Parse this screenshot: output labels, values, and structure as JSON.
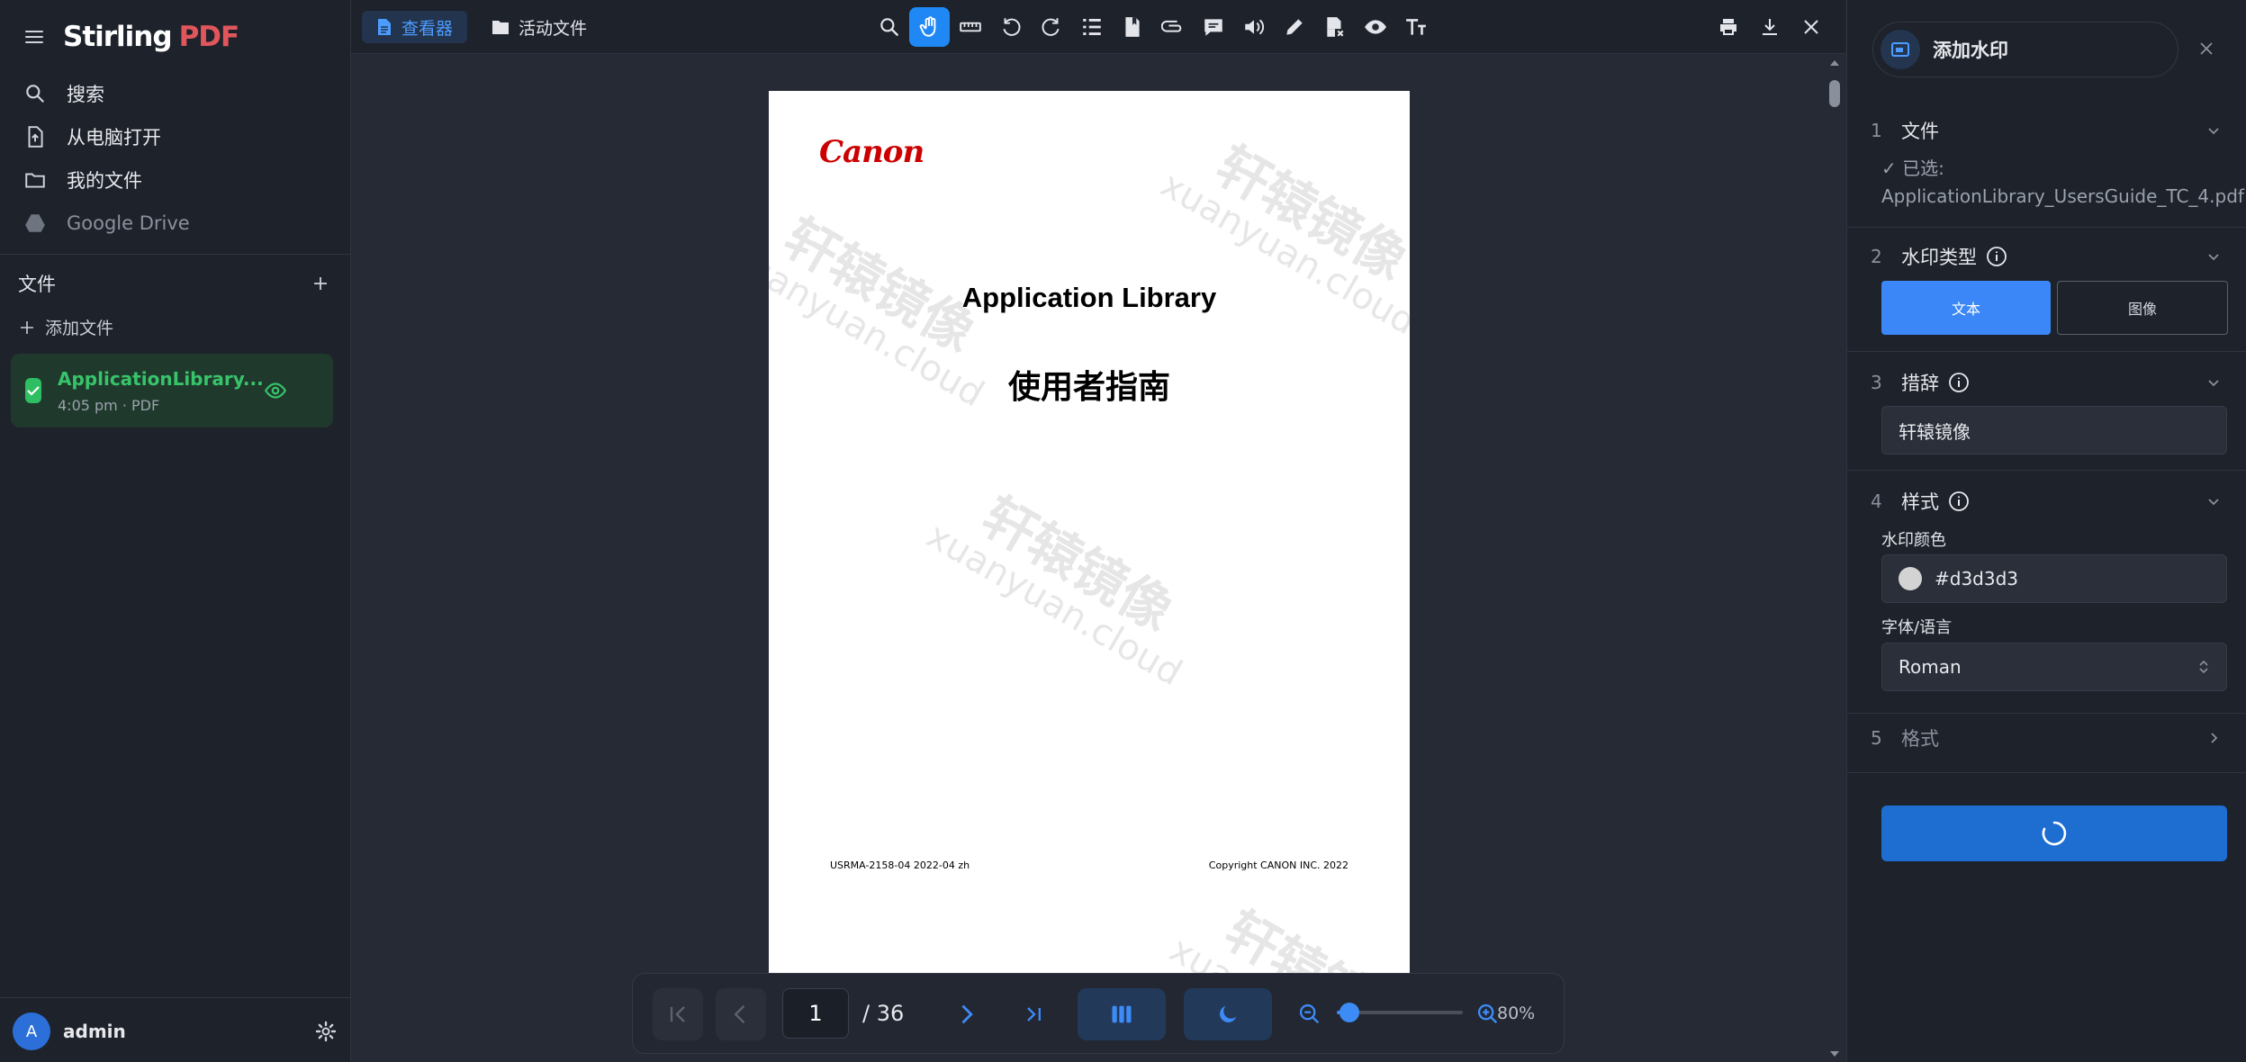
{
  "app": {
    "logo_main": "Stirling",
    "logo_accent": "PDF"
  },
  "sidebar": {
    "nav": [
      {
        "label": "搜索",
        "icon": "search-icon"
      },
      {
        "label": "从电脑打开",
        "icon": "file-upload-icon"
      },
      {
        "label": "我的文件",
        "icon": "folder-icon"
      },
      {
        "label": "Google Drive",
        "icon": "google-drive-icon"
      }
    ],
    "files_title": "文件",
    "add_file_label": "添加文件",
    "file": {
      "name": "ApplicationLibrary...",
      "meta": "4:05 pm · PDF"
    },
    "user": {
      "initial": "A",
      "name": "admin"
    }
  },
  "topbar": {
    "tab_viewer": "查看器",
    "tab_active_files": "活动文件",
    "tools": [
      "search-icon",
      "pan-hand-icon",
      "ruler-icon",
      "rotate-left-icon",
      "rotate-right-icon",
      "list-icon",
      "bookmark-file-icon",
      "paperclip-icon",
      "comment-icon",
      "speaker-icon",
      "pen-icon",
      "file-remove-icon",
      "eye-icon",
      "text-size-icon"
    ],
    "active_tool": "pan-hand-icon"
  },
  "document": {
    "brand": "Canon",
    "title": "Application Library",
    "subtitle": "使用者指南",
    "footer_left": "USRMA-2158-04 2022-04 zh",
    "footer_right": "Copyright CANON INC. 2022",
    "watermark_cn": "轩辕镜像",
    "watermark_en": "xuanyuan.cloud"
  },
  "controls": {
    "current_page": "1",
    "total_pages": "/ 36",
    "zoom": "80%",
    "zoom_fraction": 0.1
  },
  "panel": {
    "title": "添加水印",
    "steps": {
      "s1": {
        "num": "1",
        "label": "文件",
        "note_prefix": "✓ 已选:",
        "note_file": "ApplicationLibrary_UsersGuide_TC_4.pdf"
      },
      "s2": {
        "num": "2",
        "label": "水印类型",
        "opt_text": "文本",
        "opt_image": "图像"
      },
      "s3": {
        "num": "3",
        "label": "措辞",
        "value": "轩辕镜像"
      },
      "s4": {
        "num": "4",
        "label": "样式",
        "color_label": "水印颜色",
        "color_value": "#d3d3d3",
        "font_label": "字体/语言",
        "font_value": "Roman"
      },
      "s5": {
        "num": "5",
        "label": "格式"
      }
    }
  },
  "colors": {
    "accent": "#3b87f7",
    "success": "#2fbf62",
    "brand_red": "#e0565b",
    "watermark": "#d3d3d3"
  }
}
